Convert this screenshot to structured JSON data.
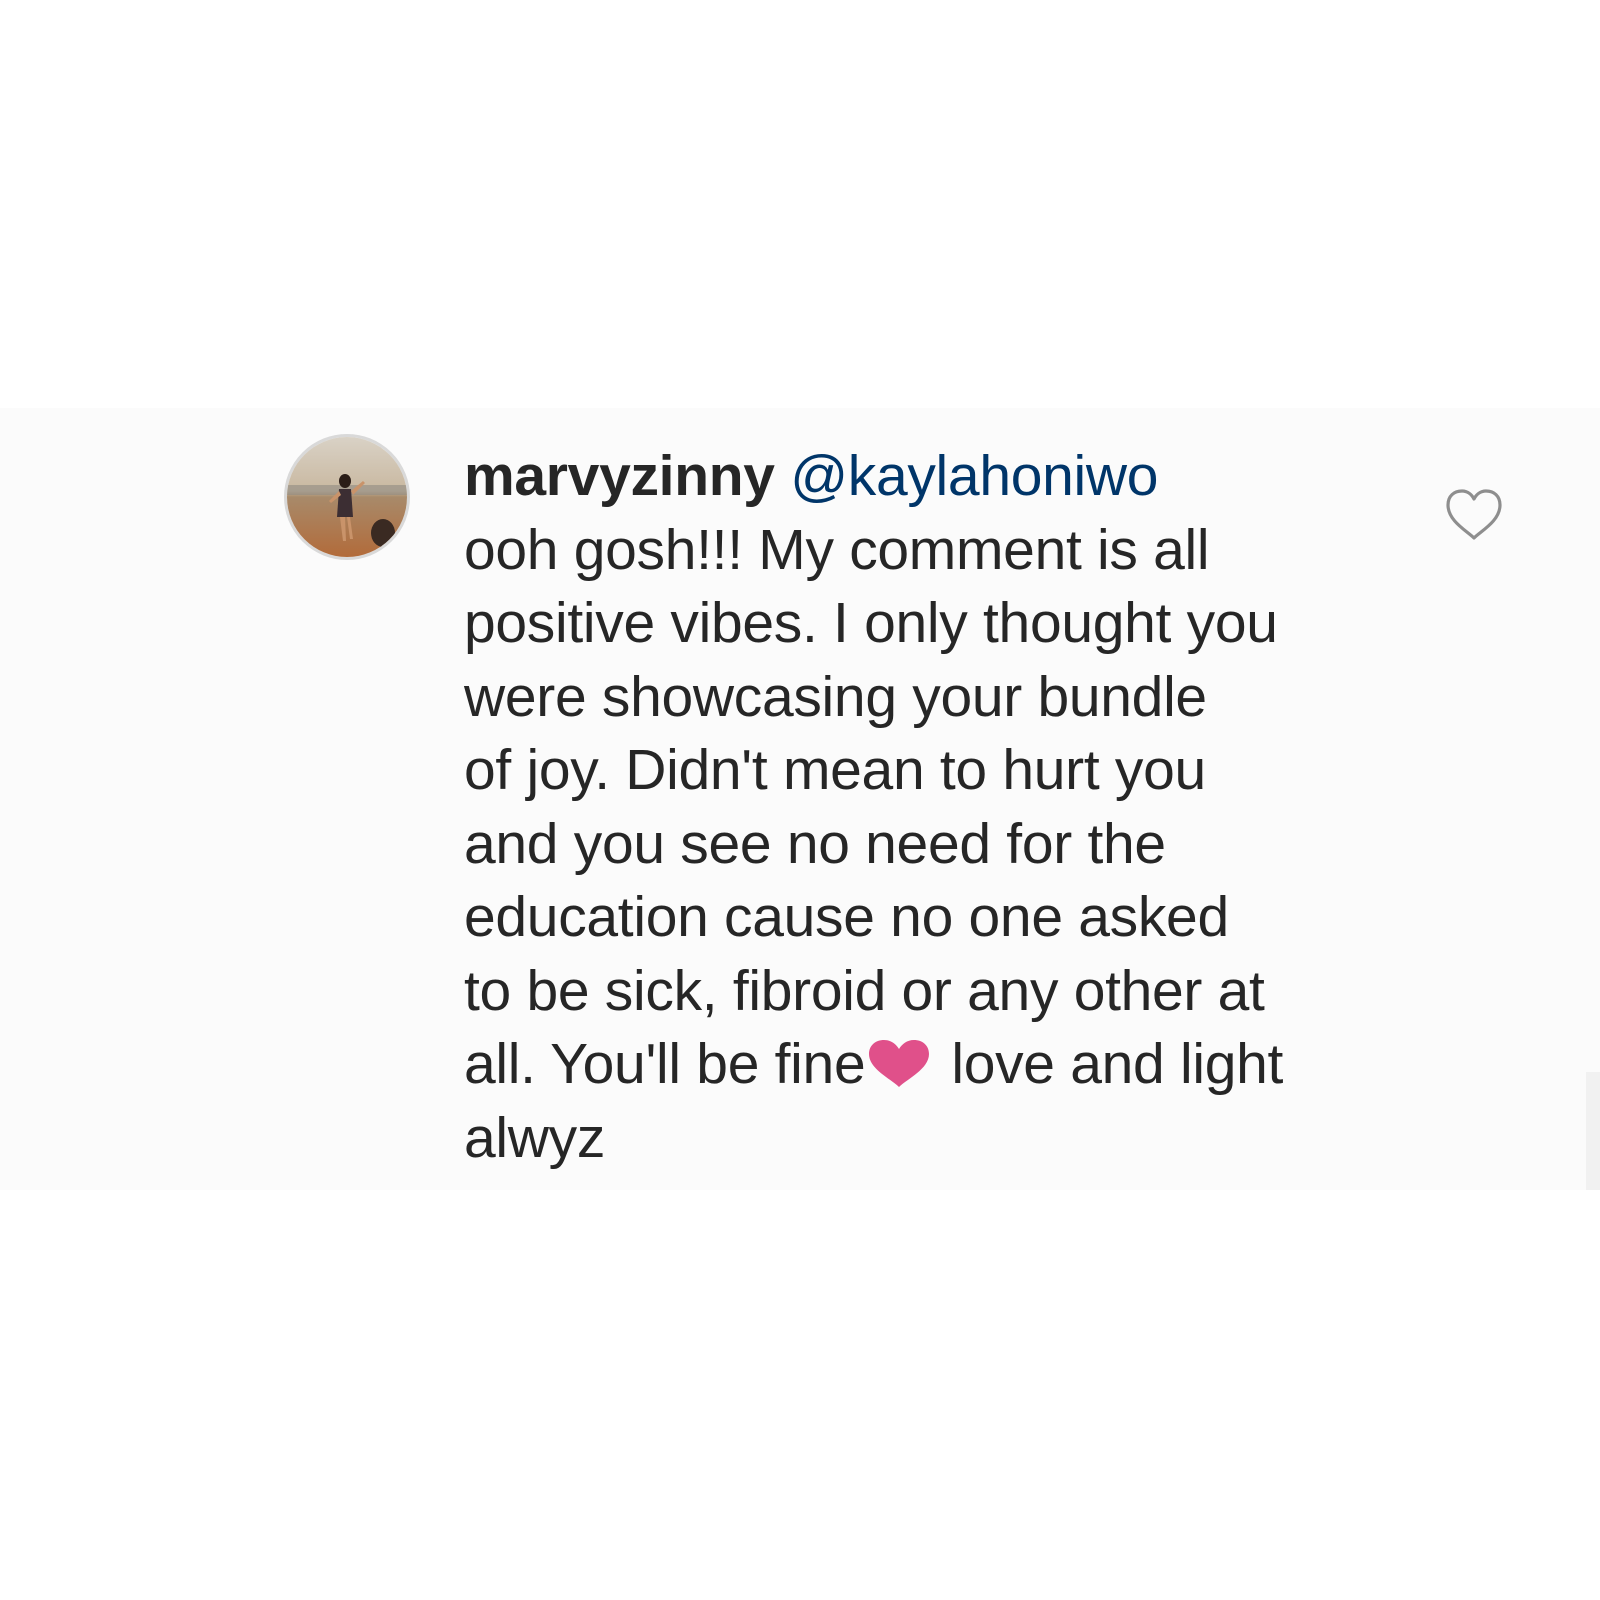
{
  "comment": {
    "username": "marvyzinny",
    "mention": "@kaylahoniwo",
    "lines": [
      "ooh gosh!!! My comment is all",
      "positive vibes. I only thought you",
      "were showcasing your bundle",
      "of joy. Didn't mean to hurt you",
      "and you see no need for the",
      "education cause no one asked",
      "to be sick, fibroid or any other at"
    ],
    "line8_before_emoji": "all. You'll be fine",
    "emoji_icon": "pink-heart-emoji",
    "line8_after_emoji": "love and light",
    "line9": "alwyz"
  },
  "like_icon": "heart-outline-icon",
  "colors": {
    "text": "#262626",
    "mention": "#003569",
    "heart_emoji": "#e0508a",
    "like_outline": "#8e8e8e"
  }
}
